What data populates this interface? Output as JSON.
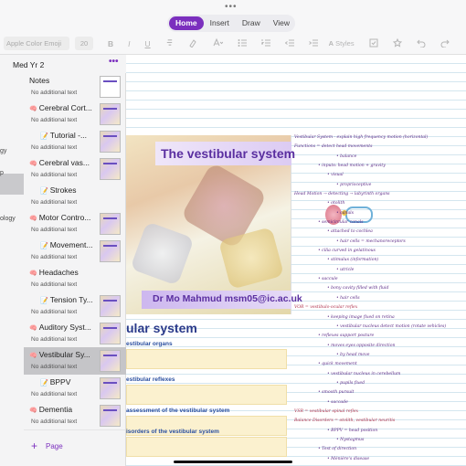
{
  "window": {
    "grabber": "•••"
  },
  "ribbon": {
    "tabs": [
      {
        "label": "Home"
      },
      {
        "label": "Insert"
      },
      {
        "label": "Draw"
      },
      {
        "label": "View"
      }
    ]
  },
  "toolbar": {
    "font": "Apple Color Emoji",
    "size": "20",
    "bold": "B",
    "italic": "I",
    "underline": "U",
    "styles": "Styles"
  },
  "sections": {
    "labels": [
      "gy",
      "p",
      "ology"
    ]
  },
  "notebook": {
    "title": "Med Yr 2",
    "more": "•••"
  },
  "pages": [
    {
      "title": "Notes",
      "subtitle": "No additional text",
      "icon": "",
      "indent": false,
      "thumb": "blank",
      "selected": false
    },
    {
      "title": "Cerebral Cort...",
      "subtitle": "No additional text",
      "icon": "🧠",
      "indent": false,
      "thumb": "slide",
      "selected": false
    },
    {
      "title": "Tutorial -...",
      "subtitle": "No additional text",
      "icon": "📝",
      "indent": true,
      "thumb": "slide",
      "selected": false
    },
    {
      "title": "Cerebral vas...",
      "subtitle": "No additional text",
      "icon": "🧠",
      "indent": false,
      "thumb": "slide",
      "selected": false
    },
    {
      "title": "Strokes",
      "subtitle": "No additional text",
      "icon": "📝",
      "indent": true,
      "thumb": "none",
      "selected": false
    },
    {
      "title": "Motor Contro...",
      "subtitle": "No additional text",
      "icon": "🧠",
      "indent": false,
      "thumb": "slide",
      "selected": false
    },
    {
      "title": "Movement...",
      "subtitle": "No additional text",
      "icon": "📝",
      "indent": true,
      "thumb": "slide",
      "selected": false
    },
    {
      "title": "Headaches",
      "subtitle": "No additional text",
      "icon": "🧠",
      "indent": false,
      "thumb": "none",
      "selected": false
    },
    {
      "title": "Tension Ty...",
      "subtitle": "No additional text",
      "icon": "📝",
      "indent": true,
      "thumb": "slide",
      "selected": false
    },
    {
      "title": "Auditory Syst...",
      "subtitle": "No additional text",
      "icon": "🧠",
      "indent": false,
      "thumb": "slide",
      "selected": false
    },
    {
      "title": "Vestibular Sy...",
      "subtitle": "No additional text",
      "icon": "🧠",
      "indent": false,
      "thumb": "slide",
      "selected": true
    },
    {
      "title": "BPPV",
      "subtitle": "No additional text",
      "icon": "📝",
      "indent": true,
      "thumb": "slide",
      "selected": false
    },
    {
      "title": "Dementia",
      "subtitle": "No additional text",
      "icon": "🧠",
      "indent": false,
      "thumb": "slide",
      "selected": false
    }
  ],
  "add_page": {
    "plus": "+",
    "label": "Page"
  },
  "slide": {
    "title": "The vestibular system",
    "author": "Dr Mo Mahmud msm05@ic.ac.uk"
  },
  "outline": {
    "title": "ular system",
    "items": [
      "estibular organs",
      "estibular reflexes",
      "assessment of the vestibular system",
      "isorders of the vestibular system"
    ]
  },
  "handwriting": [
    "Vestibular System - explain high frequency motion (horizontal)",
    "Functions = detect head movements",
    "• balance",
    "• inputs: head motion + gravity",
    "• visual",
    "• proprioceptive",
    "Head Motion → detecting → labyrinth organs",
    "• otolith",
    "• canals",
    "• semicircular canals",
    "• attached to cochlea",
    "• hair cells = mechanoreceptors",
    "• cilia curved in gelatinous",
    "• stimulus (information)",
    "• utricle",
    "• saccule",
    "• bony cavity filled with fluid",
    "• hair cells",
    "VOR = vestibulo-ocular reflex",
    "• keeping image fixed on retina",
    "• vestibular nucleus detect motion (rotate vehicles)",
    "• reflexes support posture",
    "• moves eyes opposite direction",
    "• by head move",
    "• quick movement",
    "• vestibular nucleus in cerebellum",
    "• pupils fixed",
    "• smooth pursuit",
    "• saccade",
    "VSR = vestibular spinal reflex",
    "Balance Disorders = otolith, vestibular neuritis",
    "• BPPV = head position",
    "• Nystagmus",
    "• Test of direction",
    "• Ménière's disease"
  ]
}
